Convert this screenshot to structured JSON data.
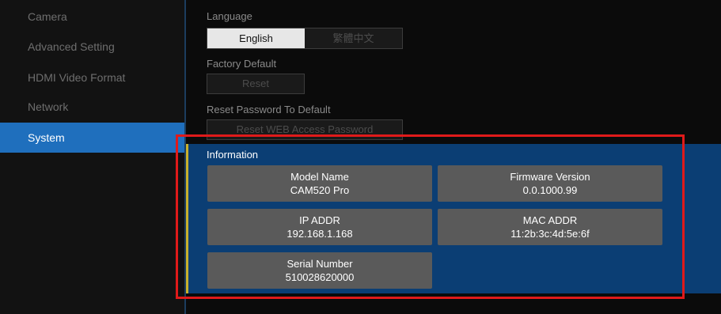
{
  "sidebar": {
    "items": [
      {
        "label": "Camera"
      },
      {
        "label": "Advanced Setting"
      },
      {
        "label": "HDMI Video Format"
      },
      {
        "label": "Network"
      },
      {
        "label": "System"
      }
    ],
    "active": "System"
  },
  "system": {
    "language": {
      "label": "Language",
      "options": [
        "English",
        "繁體中文"
      ],
      "selected": "English"
    },
    "factory_default": {
      "label": "Factory Default",
      "button": "Reset"
    },
    "reset_password": {
      "label": "Reset Password To Default",
      "button": "Reset WEB Access Password"
    },
    "information": {
      "title": "Information",
      "fields": [
        {
          "label": "Model Name",
          "value": "CAM520 Pro"
        },
        {
          "label": "Firmware Version",
          "value": "0.0.1000.99"
        },
        {
          "label": "IP ADDR",
          "value": "192.168.1.168"
        },
        {
          "label": "MAC ADDR",
          "value": "11:2b:3c:4d:5e:6f"
        },
        {
          "label": "Serial Number",
          "value": "510028620000"
        }
      ]
    }
  },
  "colors": {
    "accent": "#1f6fbd",
    "info_panel": "#0b3e74",
    "highlight": "#e01a1a"
  }
}
